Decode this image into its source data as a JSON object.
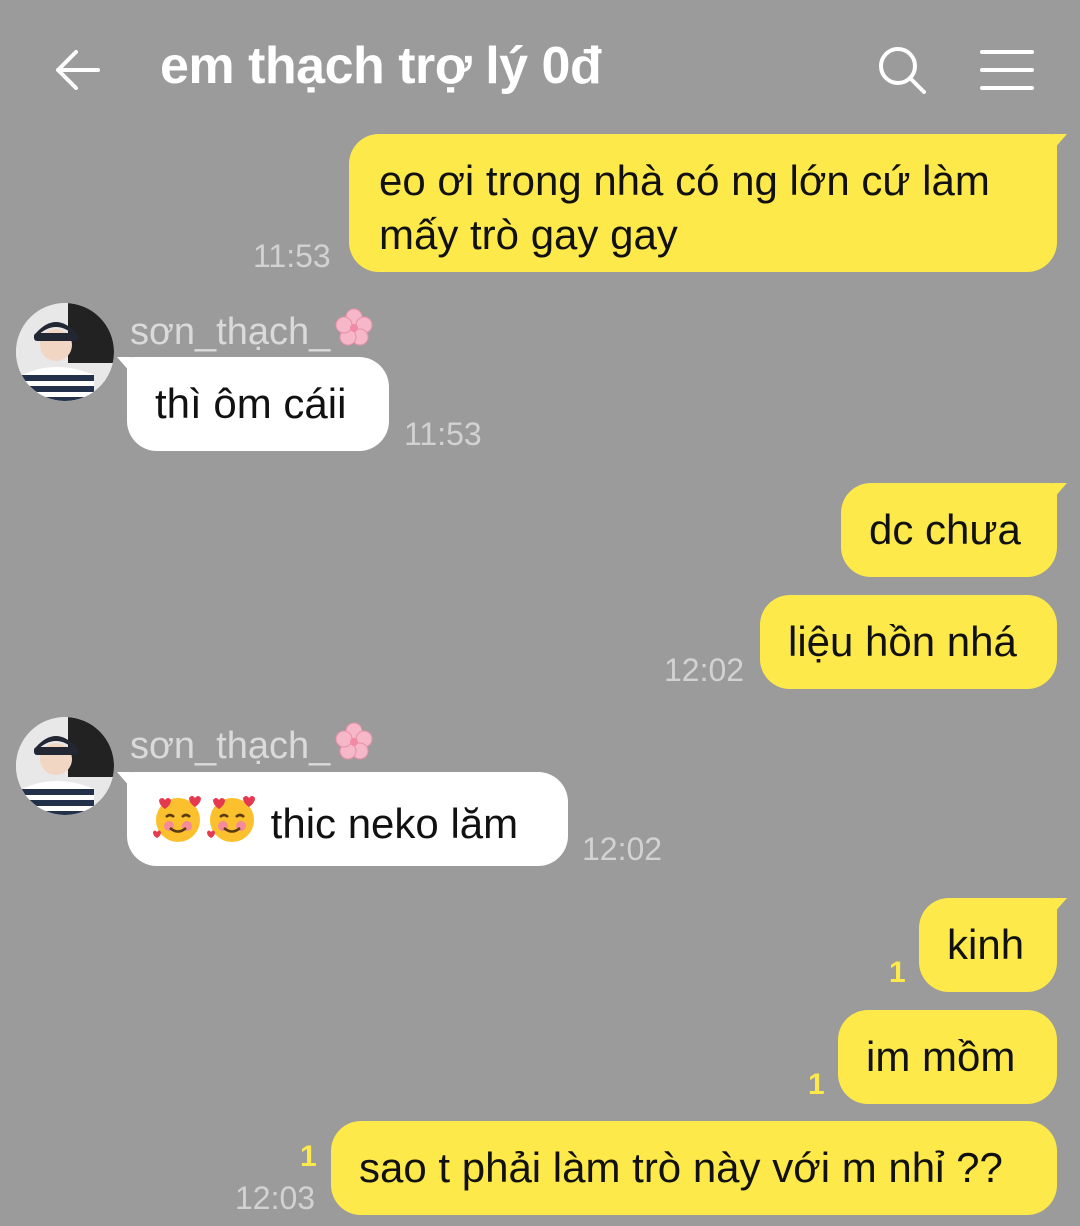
{
  "header": {
    "title": "em thạch trợ lý 0đ",
    "back_icon": "arrow-left-icon",
    "search_icon": "search-icon",
    "menu_icon": "hamburger-menu-icon"
  },
  "messages": [
    {
      "id": 0,
      "from": "me",
      "lines": [
        "eo ơi trong nhà có ng lớn cứ làm",
        "mấy trò gay gay"
      ],
      "time": "11:53"
    },
    {
      "id": 1,
      "from": "them",
      "sender": "sơn_thạch_",
      "text": "thì ôm cáii",
      "time": "11:53"
    },
    {
      "id": 2,
      "from": "me",
      "text": "dc chưa"
    },
    {
      "id": 3,
      "from": "me",
      "text": "liệu hồn nhá",
      "time": "12:02"
    },
    {
      "id": 4,
      "from": "them",
      "sender": "sơn_thạch_",
      "text": "thic neko lăm",
      "time": "12:02",
      "emoji": "smiling-face-with-hearts"
    },
    {
      "id": 5,
      "from": "me",
      "text": "kinh",
      "unread": "1"
    },
    {
      "id": 6,
      "from": "me",
      "text": "im mồm",
      "unread": "1"
    },
    {
      "id": 7,
      "from": "me",
      "text": "sao t phải làm trò này với m nhỉ ??",
      "unread": "1",
      "time": "12:03"
    }
  ],
  "colors": {
    "background": "#9b9b9b",
    "my_bubble": "#fee94a",
    "their_bubble": "#ffffff",
    "timestamp": "#d2d2d2",
    "unread": "#fee94a"
  }
}
